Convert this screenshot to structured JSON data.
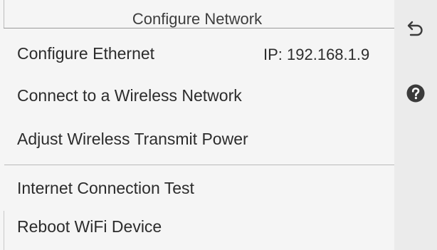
{
  "header": {
    "title": "Configure  Network"
  },
  "menu": {
    "items": [
      {
        "label": "Configure Ethernet"
      },
      {
        "label": "Connect to a Wireless Network"
      },
      {
        "label": "Adjust Wireless Transmit Power"
      },
      {
        "label": "Internet Connection Test"
      },
      {
        "label": "Reboot WiFi Device"
      }
    ]
  },
  "status": {
    "ip": "IP: 192.168.1.9"
  },
  "sidebar": {
    "back_icon": "back-arrow-icon",
    "help_icon": "help-icon"
  },
  "colors": {
    "background": "#f5f5f5",
    "sidebar": "#ebebeb",
    "text": "#2c2c2c",
    "icon": "#3b3b3b"
  }
}
